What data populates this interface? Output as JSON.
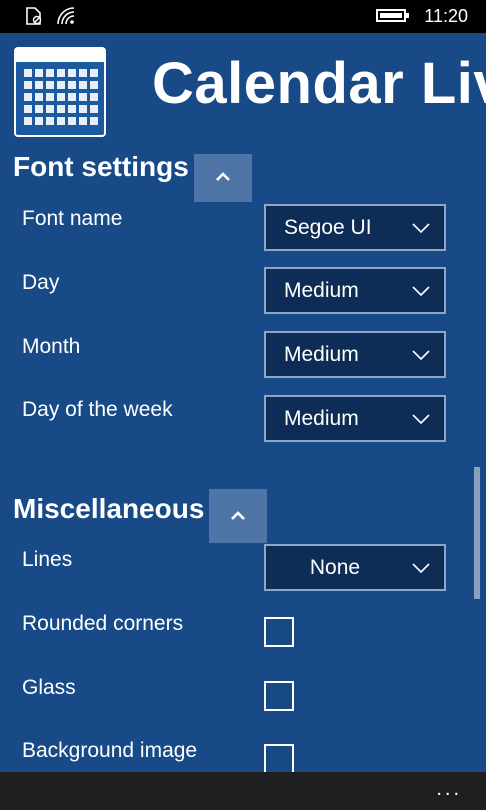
{
  "status_bar": {
    "time": "11:20",
    "icons": [
      "no-sim-icon",
      "wifi-icon",
      "battery-icon"
    ]
  },
  "header": {
    "title": "Calendar Liv",
    "icon": "calendar-icon"
  },
  "font_settings": {
    "title": "Font settings",
    "toggle_icon": "chevron-up-icon",
    "rows": [
      {
        "label": "Font name",
        "value": "Segoe UI"
      },
      {
        "label": "Day",
        "value": "Medium"
      },
      {
        "label": "Month",
        "value": "Medium"
      },
      {
        "label": "Day of the week",
        "value": "Medium"
      }
    ]
  },
  "miscellaneous": {
    "title": "Miscellaneous",
    "toggle_icon": "chevron-up-icon",
    "lines": {
      "label": "Lines",
      "value": "None"
    },
    "checkboxes": [
      {
        "label": "Rounded corners",
        "checked": false
      },
      {
        "label": "Glass",
        "checked": false
      },
      {
        "label": "Background image",
        "checked": false
      }
    ]
  },
  "app_bar": {
    "more_label": "..."
  },
  "colors": {
    "background": "#174a86",
    "select_fill": "#0e2d56",
    "accent_button": "#4f75a7"
  }
}
